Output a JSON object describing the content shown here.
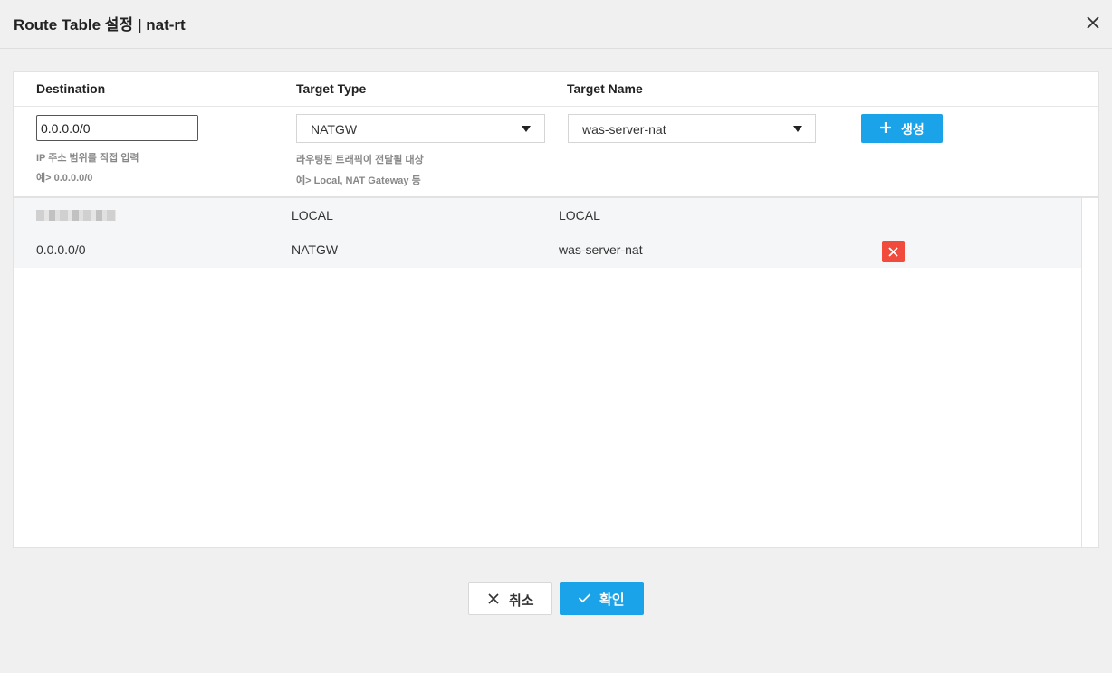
{
  "dialog": {
    "title": "Route Table 설정 | nat-rt"
  },
  "form": {
    "columns": {
      "destination": "Destination",
      "target_type": "Target Type",
      "target_name": "Target Name"
    },
    "destination_value": "0.0.0.0/0",
    "destination_help_1": "IP 주소 범위를 직접 입력",
    "destination_help_2": "예> 0.0.0.0/0",
    "target_type_value": "NATGW",
    "target_type_help_1": "라우팅된 트래픽이 전달될 대상",
    "target_type_help_2": "예> Local, NAT Gateway 등",
    "target_name_value": "was-server-nat",
    "create_label": "생성"
  },
  "routes": [
    {
      "destination": "",
      "destination_redacted": true,
      "target_type": "LOCAL",
      "target_name": "LOCAL",
      "deletable": false
    },
    {
      "destination": "0.0.0.0/0",
      "destination_redacted": false,
      "target_type": "NATGW",
      "target_name": "was-server-nat",
      "deletable": true
    }
  ],
  "footer": {
    "cancel_label": "취소",
    "confirm_label": "확인"
  },
  "colors": {
    "primary": "#1aa3e8",
    "danger": "#f04b3c"
  },
  "icons": {
    "close": "close-icon",
    "plus": "plus-icon",
    "delete": "delete-icon",
    "check": "check-icon",
    "caret": "caret-down-icon"
  }
}
